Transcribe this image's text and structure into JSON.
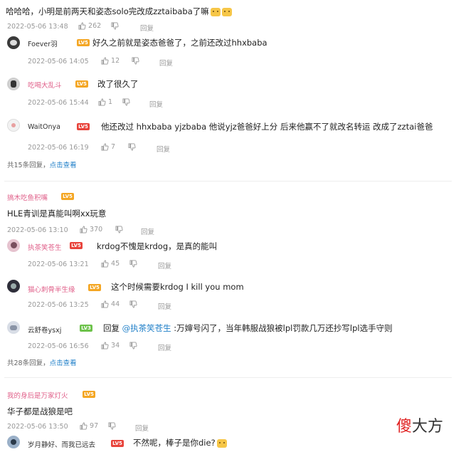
{
  "colors": {
    "badge_orange": "#f4a623",
    "badge_red": "#e8433b",
    "badge_green": "#6cc24a",
    "link": "#1f7fc8",
    "name_pink": "#e0608a"
  },
  "threads": [
    {
      "main": {
        "name": "",
        "level": "",
        "text": "哈哈哈，小明是前两天和姿态solo完改成zztaibaba了嘛",
        "emojis": [
          "cat-emoji",
          "cat-emoji"
        ],
        "time": "2022-05-06 13:48",
        "likes": "262",
        "reply": "回复"
      },
      "replies": [
        {
          "name": "Foever羽",
          "level": "LV5",
          "text": "好久之前就是姿态爸爸了，之前还改过hhxbaba",
          "time": "2022-05-06 14:05",
          "likes": "12",
          "reply": "回复"
        },
        {
          "name": "吃喝大乱斗",
          "level": "LV5",
          "text": "改了很久了",
          "time": "2022-05-06 15:44",
          "likes": "1",
          "reply": "回复"
        },
        {
          "name": "WaitOnya",
          "level": "LV5",
          "text": "他还改过 hhxbaba yjzbaba 他说yjz爸爸好上分 后来他赢不了就改名转运 改成了zztai爸爸",
          "time": "2022-05-06 16:19",
          "likes": "7",
          "reply": "回复"
        }
      ],
      "footer": {
        "count": "共15条回复，",
        "more": "点击查看"
      }
    },
    {
      "main": {
        "name": "搞木吃鱼积嘴",
        "level": "LV5",
        "text": "HLE青训是真能叫啊xx玩意",
        "time": "2022-05-06 13:10",
        "likes": "370",
        "reply": "回复"
      },
      "replies": [
        {
          "name": "执茶笑苍生",
          "level": "LV5",
          "text": "krdog不愧是krdog，是真的能叫",
          "time": "2022-05-06 13:21",
          "likes": "45",
          "reply": "回复"
        },
        {
          "name": "猫心刺骨半生缘",
          "level": "LV5",
          "text": "这个时候需要krdog I kill you mom",
          "time": "2022-05-06 13:25",
          "likes": "44",
          "reply": "回复"
        },
        {
          "name": "云舒卷ysxj",
          "level": "LV3",
          "text_prefix": "回复 ",
          "mention": "@执茶笑苍生",
          "text": " :万婶号闪了，当年韩服战狼被lpl罚款几万还抄写lpl选手守则",
          "time": "2022-05-06 16:56",
          "likes": "34",
          "reply": "回复"
        }
      ],
      "footer": {
        "count": "共28条回复，",
        "more": "点击查看"
      }
    },
    {
      "main": {
        "name": "我的身后是万家灯火",
        "level": "LV5",
        "text": "华子都是战狼是吧",
        "time": "2022-05-06 13:50",
        "likes": "97",
        "reply": "回复"
      },
      "replies": [
        {
          "name": "岁月静好、而我已远去",
          "level": "LV5",
          "text": "不然呢，棒子是你die?",
          "emojis": [
            "grin-emoji"
          ]
        }
      ]
    }
  ],
  "watermark": {
    "red": "傻",
    "black": "大方"
  }
}
